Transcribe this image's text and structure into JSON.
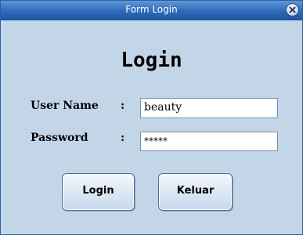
{
  "window": {
    "title": "Form Login"
  },
  "form": {
    "heading": "Login",
    "username": {
      "label": "User Name",
      "colon": ":",
      "value": "beauty"
    },
    "password": {
      "label": "Password",
      "colon": ":",
      "value": "*****"
    }
  },
  "buttons": {
    "login_label": "Login",
    "exit_label": "Keluar"
  },
  "icons": {
    "close": "close-icon"
  },
  "colors": {
    "titlebar": "#2e6bb8",
    "background": "#c3d6e8"
  }
}
